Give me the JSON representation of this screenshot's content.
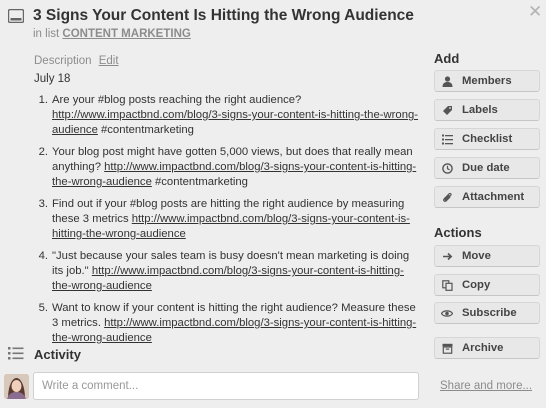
{
  "card": {
    "title": "3 Signs Your Content Is Hitting the Wrong Audience",
    "list_prefix": "in list",
    "list_name": "CONTENT MARKETING"
  },
  "description": {
    "label": "Description",
    "edit_label": "Edit",
    "date": "July 18",
    "items": [
      {
        "num": "1.",
        "before": "Are your #blog posts reaching the right audience? ",
        "link": "http://www.impactbnd.com/blog/3-signs-your-content-is-hitting-the-wrong-audience",
        "after": " #contentmarketing"
      },
      {
        "num": "2.",
        "before": "Your blog post might have gotten 5,000 views, but does that really mean anything? ",
        "link": "http://www.impactbnd.com/blog/3-signs-your-content-is-hitting-the-wrong-audience",
        "after": " #contentmarketing"
      },
      {
        "num": "3.",
        "before": "Find out if your #blog posts are hitting the right audience by measuring these 3 metrics ",
        "link": "http://www.impactbnd.com/blog/3-signs-your-content-is-hitting-the-wrong-audience",
        "after": ""
      },
      {
        "num": "4.",
        "before": "\"Just because your sales team is busy doesn't mean marketing is doing its job.\" ",
        "link": "http://www.impactbnd.com/blog/3-signs-your-content-is-hitting-the-wrong-audience",
        "after": ""
      },
      {
        "num": "5.",
        "before": "Want to know if your content is hitting the right audience? Measure these 3 metrics. ",
        "link": "http://www.impactbnd.com/blog/3-signs-your-content-is-hitting-the-wrong-audience",
        "after": ""
      }
    ]
  },
  "activity": {
    "title": "Activity",
    "comment_placeholder": "Write a comment..."
  },
  "sidebar": {
    "add_heading": "Add",
    "add_buttons": [
      {
        "label": "Members",
        "icon": "person-icon"
      },
      {
        "label": "Labels",
        "icon": "tag-icon"
      },
      {
        "label": "Checklist",
        "icon": "checklist-icon"
      },
      {
        "label": "Due date",
        "icon": "clock-icon"
      },
      {
        "label": "Attachment",
        "icon": "paperclip-icon"
      }
    ],
    "actions_heading": "Actions",
    "action_buttons": [
      {
        "label": "Move",
        "icon": "arrow-right-icon"
      },
      {
        "label": "Copy",
        "icon": "copy-icon"
      },
      {
        "label": "Subscribe",
        "icon": "eye-icon"
      },
      {
        "label": "Archive",
        "icon": "archive-icon"
      }
    ],
    "share_label": "Share and more..."
  },
  "colors": {
    "background": "#eeeeee",
    "button": "#e8e8e8",
    "muted_text": "#8c8c8c"
  }
}
